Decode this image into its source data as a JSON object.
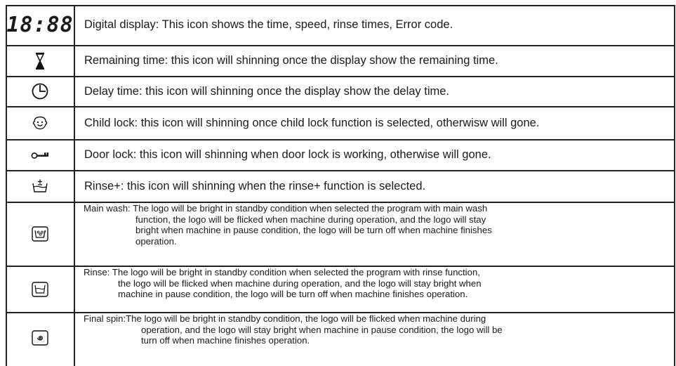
{
  "rows": [
    {
      "icon": "digital-display-icon",
      "glyph": "18:88",
      "text": "Digital display: This icon shows the time, speed, rinse times, Error code."
    },
    {
      "icon": "hourglass-icon",
      "text": "Remaining time: this icon will shinning once the display show the remaining time."
    },
    {
      "icon": "clock-icon",
      "text": "Delay time: this icon will shinning once the display show the delay time."
    },
    {
      "icon": "child-face-icon",
      "text": "Child lock: this icon will shinning once child lock function is selected, otherwisw will gone."
    },
    {
      "icon": "key-icon",
      "text": "Door lock: this icon will shinning when door lock is working, otherwise will gone."
    },
    {
      "icon": "rinse-plus-icon",
      "text": "Rinse+: this icon will shinning when the rinse+ function is selected."
    },
    {
      "icon": "main-wash-icon",
      "lines": [
        "Main wash: The logo will be bright in standby condition when selected the program with main wash",
        "function, the logo will be flicked when machine during operation, and the logo will stay",
        "bright when machine in pause condition, the logo will be turn off when machine finishes",
        "operation."
      ]
    },
    {
      "icon": "rinse-icon",
      "lines": [
        "Rinse: The logo will be bright in standby condition when selected the program with rinse function,",
        "the logo will be flicked when machine during operation, and the logo will stay bright when",
        "machine in pause condition, the logo will be turn off when machine finishes operation."
      ]
    },
    {
      "icon": "final-spin-icon",
      "lines": [
        "Final spin:The logo will be bright in standby condition, the logo will be flicked when machine during",
        "operation, and the logo will stay bright when machine in pause condition, the logo will be",
        "turn off when machine finishes operation."
      ]
    }
  ]
}
